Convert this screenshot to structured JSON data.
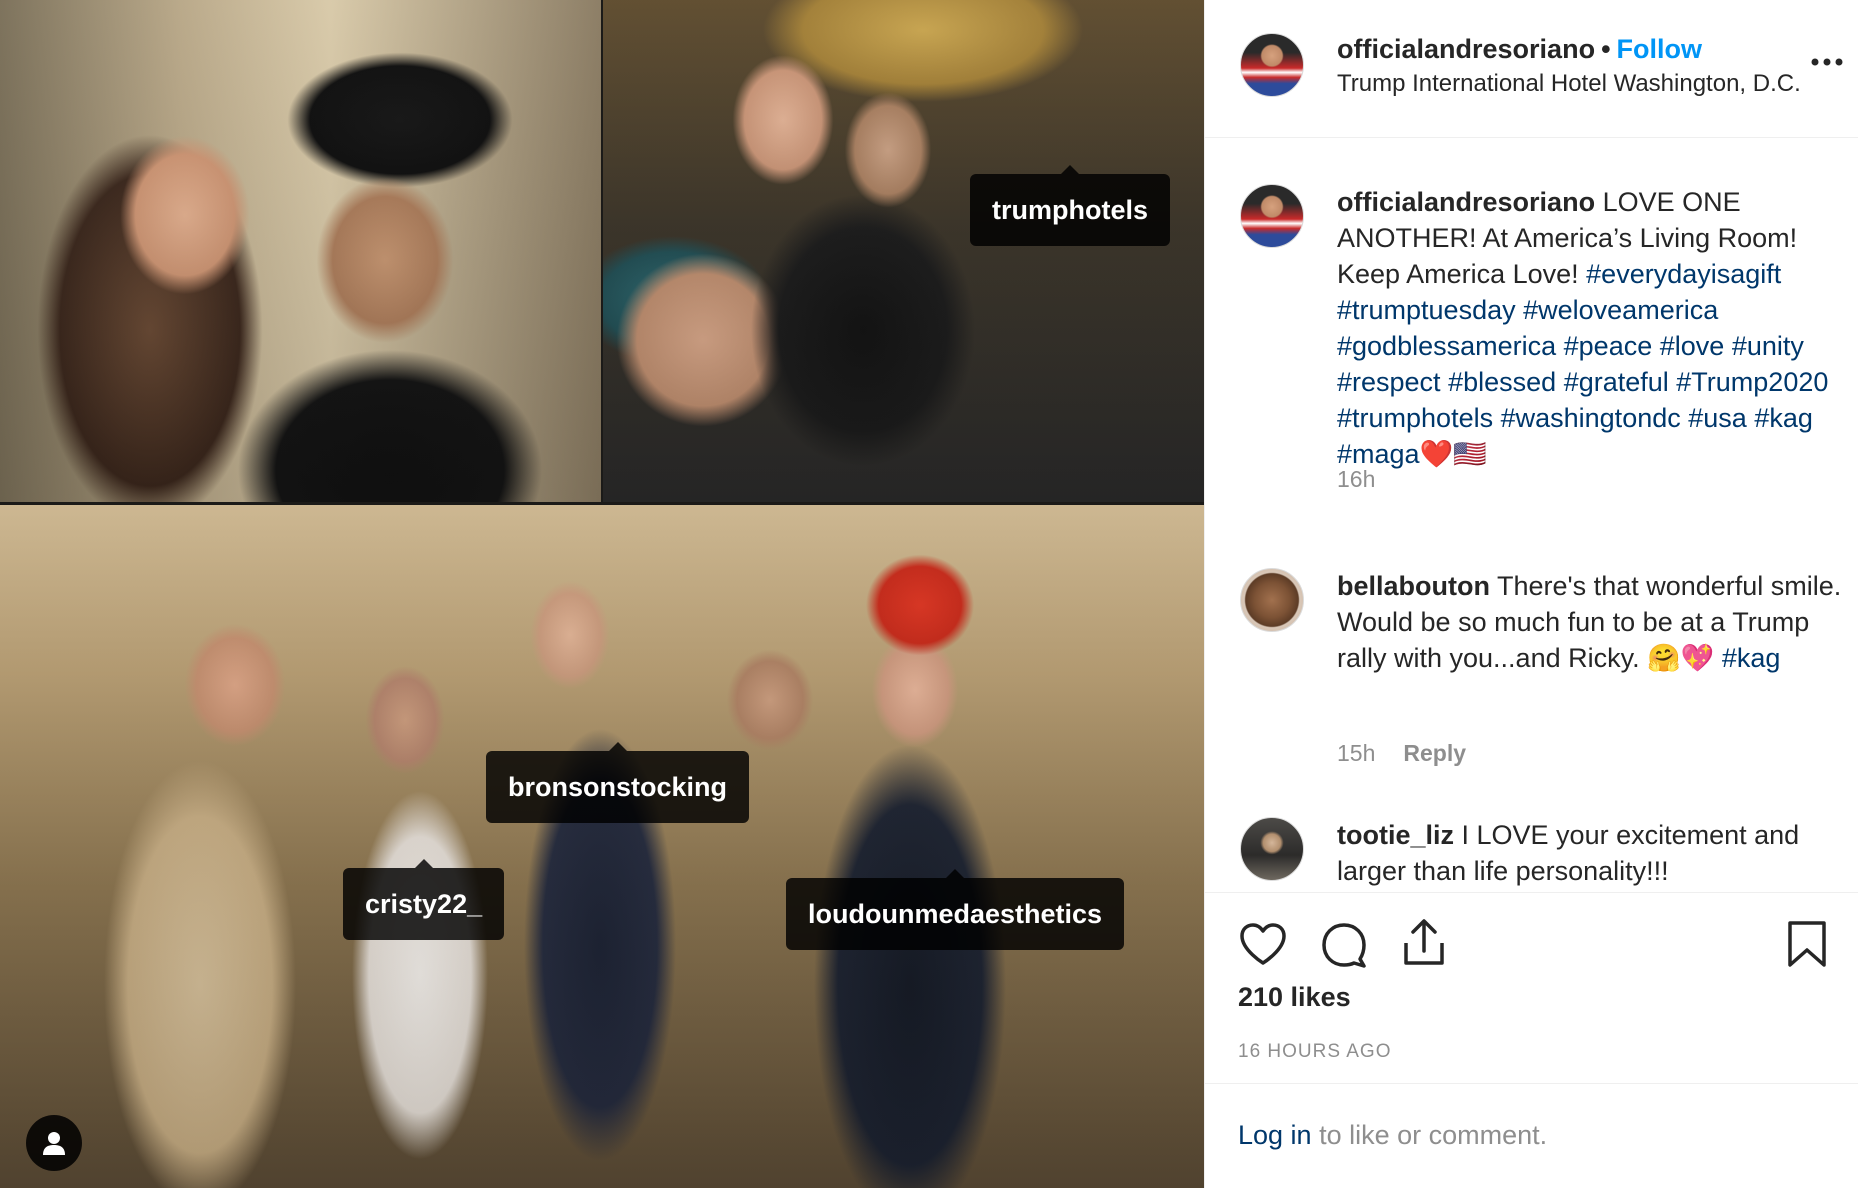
{
  "post": {
    "username": "officialandresoriano",
    "separator": "•",
    "follow_label": "Follow",
    "location": "Trump International Hotel Washington, D.C.",
    "more_icon": "more-options-icon"
  },
  "media": {
    "tags": {
      "trumphotels": "trumphotels",
      "bronsonstocking": "bronsonstocking",
      "cristy22": "cristy22_",
      "loudoun": "loudounmedaesthetics"
    },
    "user_tags_icon": "person-icon"
  },
  "caption": {
    "username": "officialandresoriano",
    "text": " LOVE ONE ANOTHER! At America’s Living Room! Keep America Love! ",
    "hashtags": [
      "#everydayisagift",
      "#trumptuesday",
      "#weloveamerica",
      "#godblessamerica",
      "#peace",
      "#love",
      "#unity",
      "#respect",
      "#blessed",
      "#grateful",
      "#Trump2020",
      "#trumphotels",
      "#washingtondc",
      "#usa",
      "#kag",
      "#maga"
    ],
    "emoji": "❤️🇺🇸",
    "time": "16h"
  },
  "comments": [
    {
      "username": "bellabouton",
      "text": " There's that wonderful smile. Would be so much fun to be at a Trump rally with you...and Ricky. 🤗💖 ",
      "hashtag": "#kag",
      "time": "15h",
      "reply_label": "Reply"
    },
    {
      "username": "tootie_liz",
      "text": " I LOVE your excitement and larger than life personality!!!"
    }
  ],
  "actions": {
    "like_icon": "heart-icon",
    "comment_icon": "comment-icon",
    "share_icon": "share-icon",
    "save_icon": "bookmark-icon",
    "likes": "210 likes",
    "timestamp": "16 HOURS AGO"
  },
  "login": {
    "link": "Log in",
    "rest": " to like or comment."
  },
  "colors": {
    "link_blue": "#0095f6",
    "hashtag_blue": "#00376b",
    "muted_gray": "#8e8e8e",
    "text": "#262626"
  }
}
